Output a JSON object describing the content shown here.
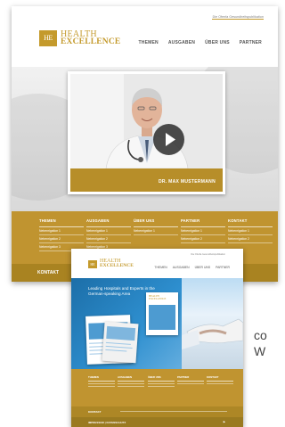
{
  "back_page": {
    "top_link": "Die Ofenfa Gesundheitspublikation",
    "logo": {
      "monogram": "HE",
      "line1": "HEALTH",
      "line2": "EXCELLENCE"
    },
    "nav": [
      "THEMEN",
      "AUSGABEN",
      "ÜBER UNS",
      "PARTNER"
    ],
    "video": {
      "caption": "DR. MAX MUSTERMANN",
      "icon": "play-icon"
    },
    "footer_columns": [
      {
        "title": "THEMEN",
        "links": [
          "Nebenrigation 1",
          "Nebenrigation 2",
          "Nebenrigation 3"
        ]
      },
      {
        "title": "AUSGABEN",
        "links": [
          "Nebenrigation 1",
          "Nebenrigation 2",
          "Nebenrigation 3"
        ]
      },
      {
        "title": "ÜBER UNS",
        "links": [
          "Nebenrigation 1"
        ]
      },
      {
        "title": "PARTNER",
        "links": [
          "Nebenrigation 1",
          "Nebenrigation 2"
        ]
      },
      {
        "title": "KONTAKT",
        "links": [
          "Nebenrigation 1",
          "Nebenrigation 2"
        ]
      }
    ],
    "bottom_label": "KONTAKT"
  },
  "front_page": {
    "logo": {
      "monogram": "HE",
      "line1": "HEALTH",
      "line2": "EXCELLENCE"
    },
    "nav": [
      "THEMEN",
      "AUSGABEN",
      "ÜBER UNS",
      "PARTNER"
    ],
    "hero_text": "Leading Hospitals and Experts in the German-speaking Area",
    "magazine_title_line1": "HEALTH",
    "magazine_title_line2": "EXCELLENCE",
    "footer_columns": [
      "THEMEN",
      "AUSGABEN",
      "ÜBER UNS",
      "PARTNER",
      "KONTAKT"
    ],
    "bottom_label": "KONTAKT",
    "bottom_label_2": "IMPRESSUM | DATENSCHUTZ"
  },
  "side_text": {
    "line1": "co",
    "line2": "W"
  },
  "colors": {
    "gold": "#c09430",
    "gold_dark": "#a98321",
    "blue": "#2e8fcf"
  }
}
